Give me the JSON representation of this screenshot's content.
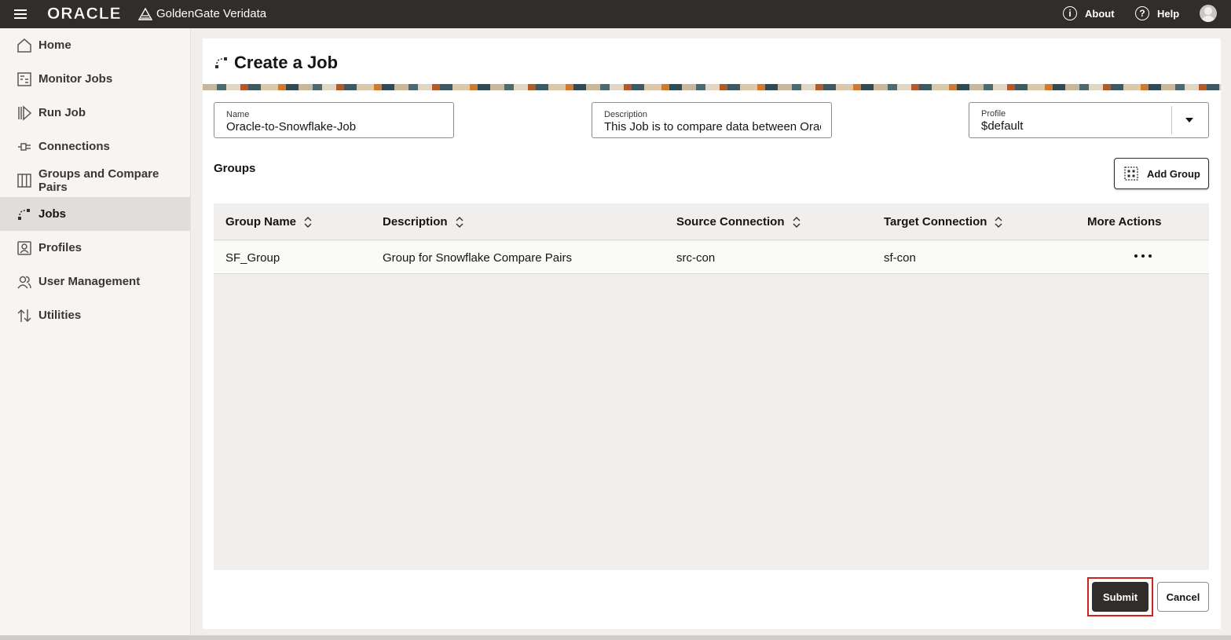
{
  "topbar": {
    "brand": "ORACLE",
    "product": "GoldenGate Veridata",
    "about_label": "About",
    "help_label": "Help"
  },
  "sidebar": {
    "items": [
      {
        "label": "Home",
        "icon": "home-icon"
      },
      {
        "label": "Monitor Jobs",
        "icon": "monitor-jobs-icon"
      },
      {
        "label": "Run Job",
        "icon": "run-job-icon"
      },
      {
        "label": "Connections",
        "icon": "connections-icon"
      },
      {
        "label": "Groups and Compare Pairs",
        "icon": "groups-icon"
      },
      {
        "label": "Jobs",
        "icon": "jobs-icon",
        "active": true
      },
      {
        "label": "Profiles",
        "icon": "profiles-icon"
      },
      {
        "label": "User Management",
        "icon": "users-icon"
      },
      {
        "label": "Utilities",
        "icon": "utilities-icon"
      }
    ]
  },
  "page": {
    "title": "Create a Job"
  },
  "form": {
    "name_label": "Name",
    "name_value": "Oracle-to-Snowflake-Job",
    "description_label": "Description",
    "description_value": "This Job is to compare data between Orac",
    "profile_label": "Profile",
    "profile_value": "$default"
  },
  "groups": {
    "label": "Groups",
    "add_button": "Add Group",
    "columns": [
      "Group Name",
      "Description",
      "Source Connection",
      "Target Connection",
      "More Actions"
    ],
    "rows": [
      {
        "group_name": "SF_Group",
        "description": "Group for Snowflake Compare Pairs",
        "source": "src-con",
        "target": "sf-con"
      }
    ]
  },
  "actions": {
    "submit": "Submit",
    "cancel": "Cancel"
  }
}
